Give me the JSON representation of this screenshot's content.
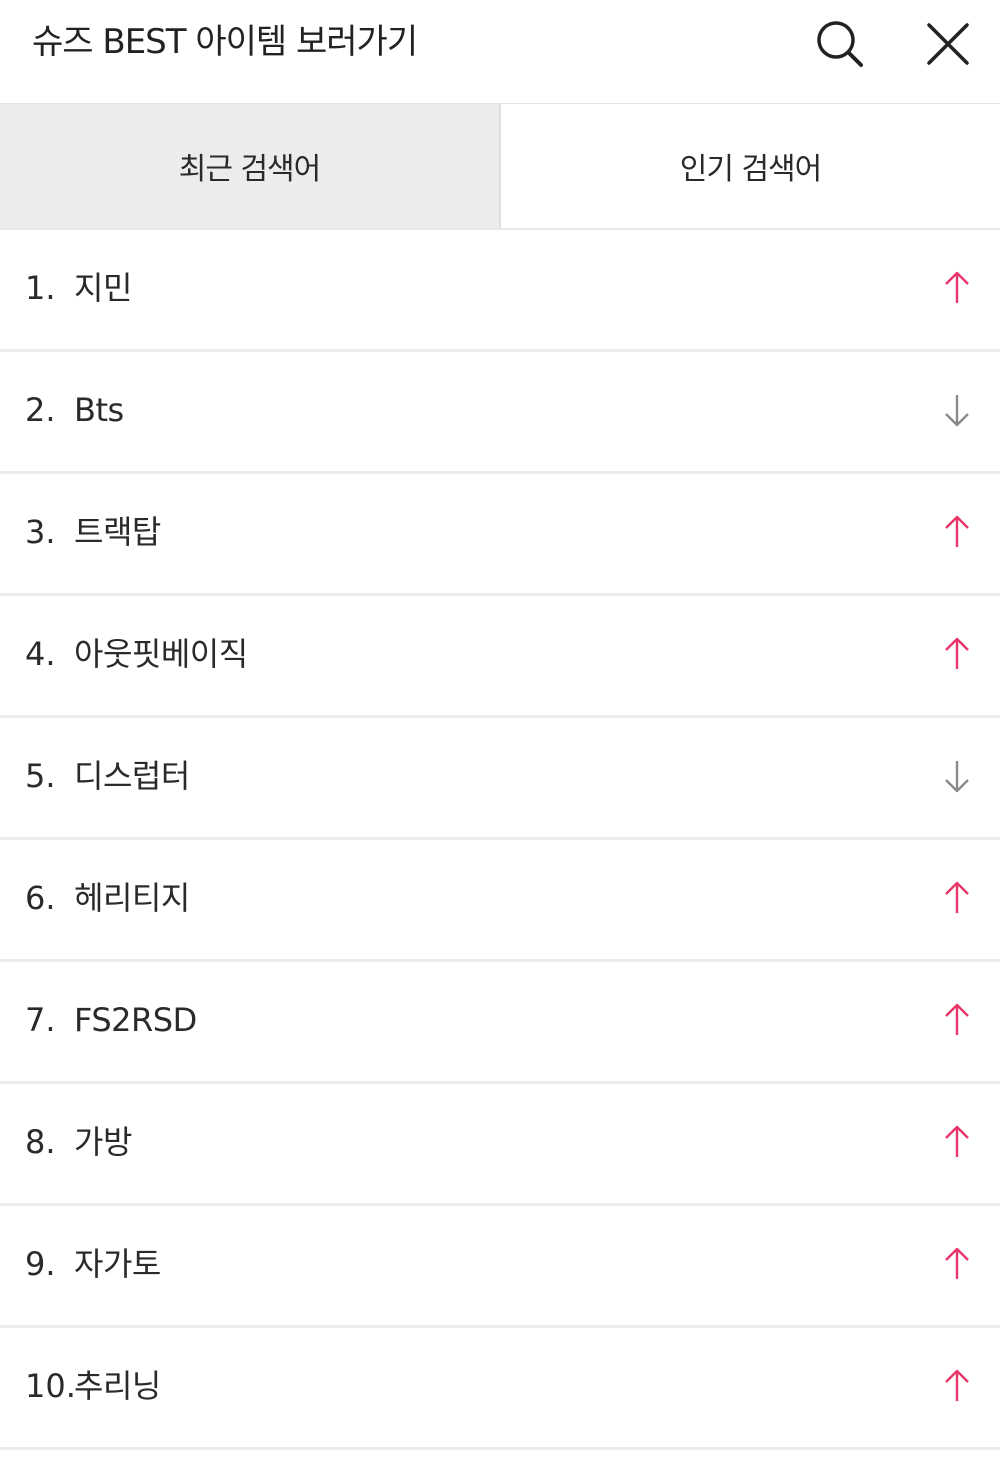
{
  "header": {
    "title": "슈즈 BEST 아이템 보러가기",
    "search_icon": "search-icon",
    "close_icon": "close-icon"
  },
  "tabs": [
    {
      "label": "최근 검색어",
      "selected": false
    },
    {
      "label": "인기 검색어",
      "selected": true
    }
  ],
  "colors": {
    "trend_up": "#e8356a",
    "trend_down": "#8a8a8a"
  },
  "ranking": [
    {
      "rank": "1.",
      "term": "지민",
      "trend": "up"
    },
    {
      "rank": "2.",
      "term": "Bts",
      "trend": "down"
    },
    {
      "rank": "3.",
      "term": "트랙탑",
      "trend": "up"
    },
    {
      "rank": "4.",
      "term": "아웃핏베이직",
      "trend": "up"
    },
    {
      "rank": "5.",
      "term": "디스럽터",
      "trend": "down"
    },
    {
      "rank": "6.",
      "term": "헤리티지",
      "trend": "up"
    },
    {
      "rank": "7.",
      "term": "FS2RSD",
      "trend": "up"
    },
    {
      "rank": "8.",
      "term": "가방",
      "trend": "up"
    },
    {
      "rank": "9.",
      "term": "자가토",
      "trend": "up"
    },
    {
      "rank": "10.",
      "term": "추리닝",
      "trend": "up"
    }
  ]
}
